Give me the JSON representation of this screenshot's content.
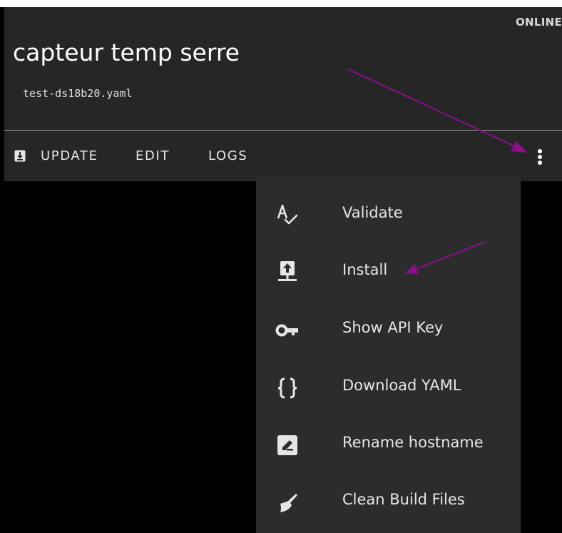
{
  "device": {
    "status": "ONLINE",
    "name": "capteur temp serre",
    "filename": "test-ds18b20.yaml"
  },
  "actions": {
    "update": "UPDATE",
    "edit": "EDIT",
    "logs": "LOGS"
  },
  "menu": {
    "items": [
      {
        "label": "Validate",
        "icon": "validate-icon"
      },
      {
        "label": "Install",
        "icon": "install-icon"
      },
      {
        "label": "Show API Key",
        "icon": "key-icon"
      },
      {
        "label": "Download YAML",
        "icon": "code-braces-icon"
      },
      {
        "label": "Rename hostname",
        "icon": "rename-icon"
      },
      {
        "label": "Clean Build Files",
        "icon": "broom-icon"
      }
    ]
  },
  "annotations": {
    "arrow_color": "#8b108b"
  }
}
